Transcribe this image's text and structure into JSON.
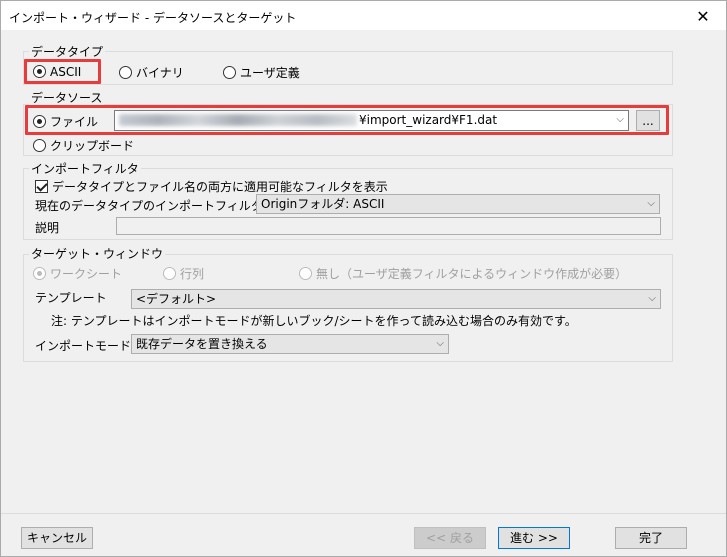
{
  "window": {
    "title": "インポート・ウィザード - データソースとターゲット",
    "close_glyph": "✕"
  },
  "data_type": {
    "legend": "データタイプ",
    "options": [
      {
        "label": "ASCII",
        "selected": true
      },
      {
        "label": "バイナリ",
        "selected": false
      },
      {
        "label": "ユーザ定義",
        "selected": false
      }
    ]
  },
  "data_source": {
    "legend": "データソース",
    "file_label": "ファイル",
    "file_path_visible": "¥import_wizard¥F1.dat",
    "browse_label": "...",
    "clipboard_label": "クリップボード"
  },
  "import_filter": {
    "legend": "インポートフィルタ",
    "show_applicable_label": "データタイプとファイル名の両方に適用可能なフィルタを表示",
    "current_filter_label": "現在のデータタイプのインポートフィルタ",
    "current_filter_value": "Originフォルダ: ASCII",
    "description_label": "説明"
  },
  "target_window": {
    "legend": "ターゲット・ウィンドウ",
    "options": [
      {
        "label": "ワークシート",
        "selected": true
      },
      {
        "label": "行列",
        "selected": false
      },
      {
        "label": "無し（ユーザ定義フィルタによるウィンドウ作成が必要）",
        "selected": false
      }
    ],
    "template_label": "テンプレート",
    "template_value": "<デフォルト>",
    "note": "注: テンプレートはインポートモードが新しいブック/シートを作って読み込む場合のみ有効です。",
    "import_mode_label": "インポートモード",
    "import_mode_value": "既存データを置き換える"
  },
  "footer": {
    "cancel": "キャンセル",
    "back": "<< 戻る",
    "next": "進む >>",
    "finish": "完了"
  },
  "colors": {
    "highlight": "#e83b3b",
    "default_button_border": "#0078d7"
  }
}
